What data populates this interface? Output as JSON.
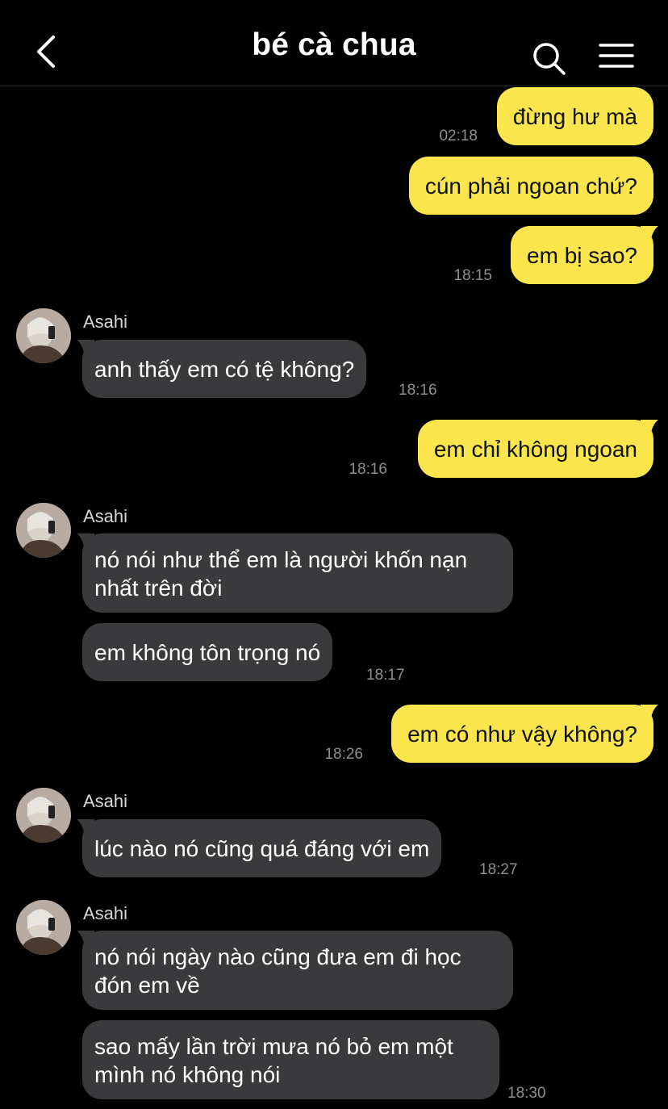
{
  "header": {
    "title": "bé cà chua",
    "back_icon": "chevron-left-icon",
    "search_icon": "search-icon",
    "menu_icon": "hamburger-menu-icon"
  },
  "colors": {
    "background": "#000000",
    "my_bubble": "#fae64c",
    "their_bubble": "#3a3a3c",
    "timestamp": "#8e8e93"
  },
  "messages": [
    {
      "from": "me",
      "text": "đừng hư mà",
      "time": "02:18"
    },
    {
      "from": "me",
      "text": "cún phải ngoan chứ?",
      "time": ""
    },
    {
      "from": "me",
      "text": "em bị sao?",
      "time": "18:15"
    },
    {
      "from": "them",
      "sender": "Asahi",
      "text": "anh thấy em có tệ không?",
      "time": "18:16"
    },
    {
      "from": "me",
      "text": "em chỉ không ngoan",
      "time": "18:16"
    },
    {
      "from": "them",
      "sender": "Asahi",
      "text": "nó nói như thể em là người khốn nạn nhất trên đời",
      "time": ""
    },
    {
      "from": "them",
      "text": "em không tôn trọng nó",
      "time": "18:17"
    },
    {
      "from": "me",
      "text": "em có như vậy không?",
      "time": "18:26"
    },
    {
      "from": "them",
      "sender": "Asahi",
      "text": "lúc nào nó cũng quá đáng với em",
      "time": "18:27"
    },
    {
      "from": "them",
      "sender": "Asahi",
      "text": "nó nói ngày nào cũng đưa em đi học đón em về",
      "time": ""
    },
    {
      "from": "them",
      "text": "sao mấy lần trời mưa nó bỏ em một mình nó không nói",
      "time": "18:30"
    }
  ]
}
